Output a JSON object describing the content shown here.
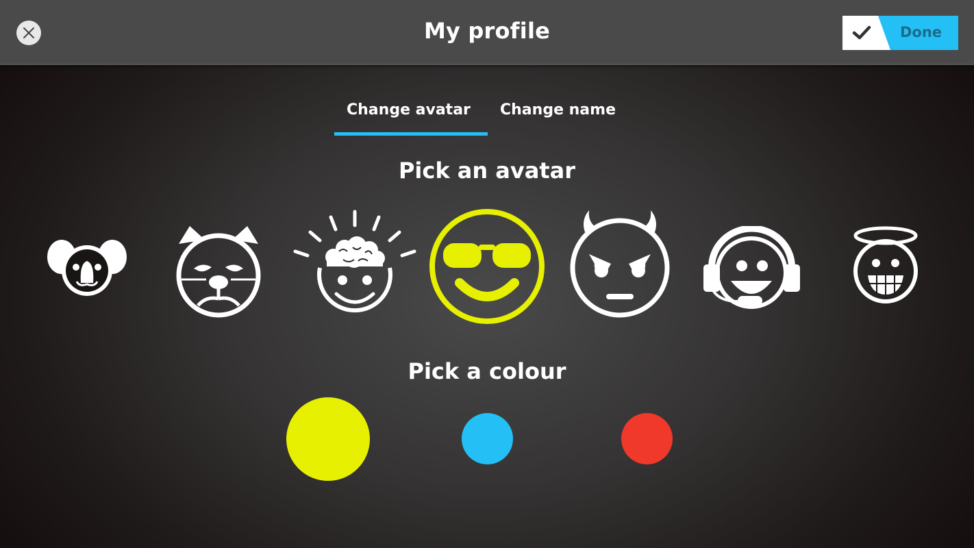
{
  "header": {
    "title": "My profile",
    "close_icon": "close-icon",
    "done_label": "Done",
    "done_icon": "checkmark-icon"
  },
  "tabs": [
    {
      "label": "Change avatar",
      "active": true
    },
    {
      "label": "Change name",
      "active": false
    }
  ],
  "avatar_section": {
    "title": "Pick an avatar",
    "selected_index": 3,
    "avatars": [
      {
        "name": "koala",
        "icon": "koala-icon"
      },
      {
        "name": "grumpy-cat",
        "icon": "cat-icon"
      },
      {
        "name": "brain",
        "icon": "brain-icon"
      },
      {
        "name": "sunglasses-smiley",
        "icon": "sunglasses-smiley-icon"
      },
      {
        "name": "devil",
        "icon": "devil-icon"
      },
      {
        "name": "headset",
        "icon": "headset-smiley-icon"
      },
      {
        "name": "angel",
        "icon": "angel-icon"
      }
    ]
  },
  "colour_section": {
    "title": "Pick a colour",
    "selected_index": 0,
    "colours": [
      {
        "name": "yellow",
        "hex": "#e6f000"
      },
      {
        "name": "blue",
        "hex": "#24c0f5"
      },
      {
        "name": "red",
        "hex": "#f0392b"
      }
    ]
  },
  "theme": {
    "accent": "#24c0f5",
    "selected_avatar_color": "#e6f000",
    "icon_color": "#ffffff"
  }
}
